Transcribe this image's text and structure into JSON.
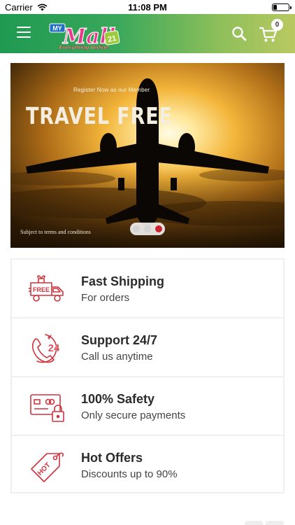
{
  "status_bar": {
    "carrier": "Carrier",
    "time": "11:08 PM",
    "battery_level": 0.25
  },
  "header": {
    "logo": {
      "text_top": "MY",
      "text_main": "Mall",
      "text_badge": "21",
      "tagline": "Everything Online"
    },
    "cart_count": "0",
    "icons": {
      "menu": "hamburger-menu-icon",
      "search": "search-icon",
      "cart": "shopping-cart-icon"
    }
  },
  "banner": {
    "small_text": "Register Now as our Member",
    "title": "TRAVEL FREE",
    "terms": "Subject to terms and conditions",
    "slides": 3,
    "active_slide": 3
  },
  "features": [
    {
      "icon": "free-delivery-truck-icon",
      "title": "Fast Shipping",
      "subtitle": "For orders",
      "icon_text": "FREE"
    },
    {
      "icon": "support-24-phone-icon",
      "title": "Support 24/7",
      "subtitle": "Call us anytime",
      "icon_text": "24"
    },
    {
      "icon": "secure-card-lock-icon",
      "title": "100% Safety",
      "subtitle": "Only secure payments",
      "icon_text": ""
    },
    {
      "icon": "hot-offer-tag-icon",
      "title": "Hot Offers",
      "subtitle": "Discounts up to 90%",
      "icon_text": "HOT"
    }
  ],
  "colors": {
    "header_start": "#1f9a52",
    "header_end": "#b9c962",
    "accent_red": "#d1343e",
    "active_dot": "#c8252e"
  }
}
